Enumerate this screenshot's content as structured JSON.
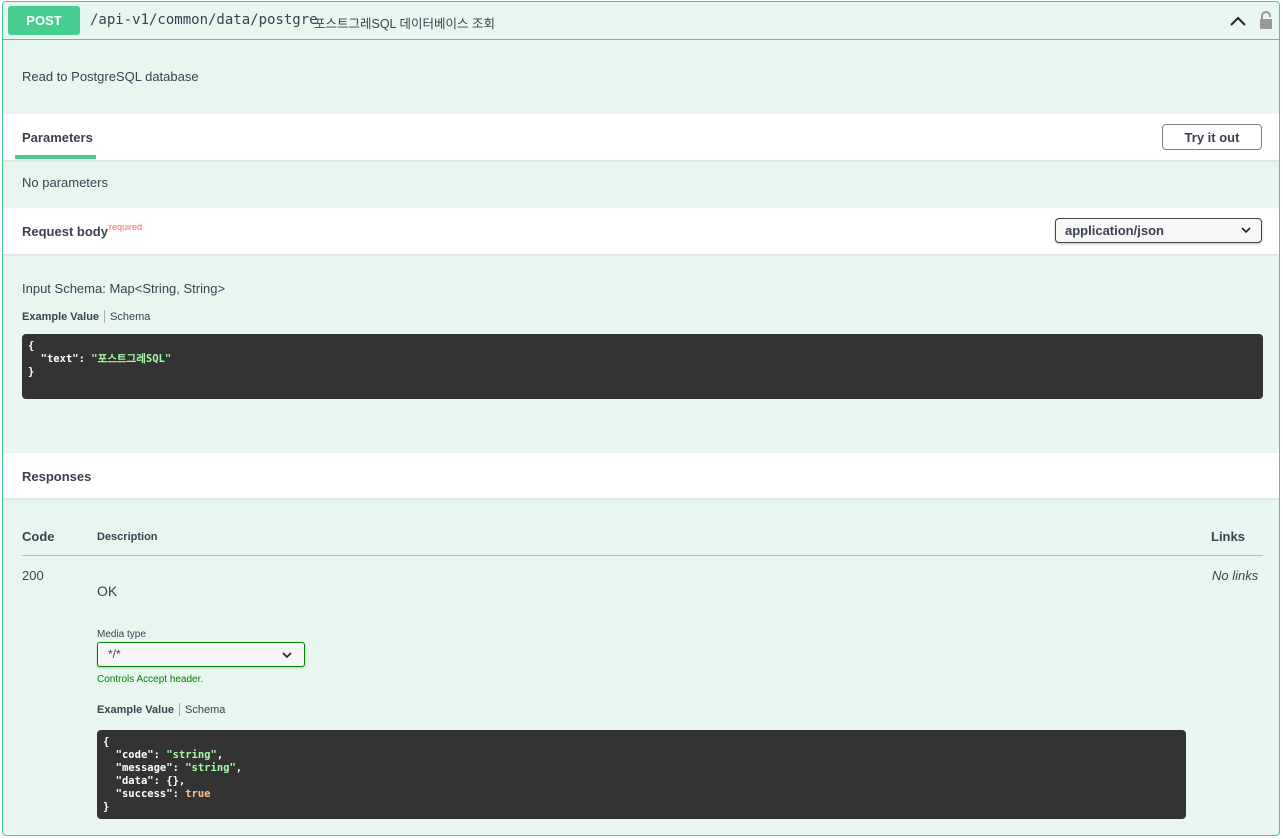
{
  "endpoint": {
    "method": "POST",
    "path": "/api-v1/common/data/postgre",
    "summary": "포스트그레SQL 데이터베이스 조회",
    "description": "Read to PostgreSQL database"
  },
  "parameters": {
    "title": "Parameters",
    "try_button": "Try it out",
    "empty_text": "No parameters"
  },
  "request_body": {
    "title": "Request body",
    "required_label": "required",
    "content_type": "application/json",
    "input_schema": "Input Schema: Map<String, String>",
    "tab_example": "Example Value",
    "tab_schema": "Schema",
    "example": {
      "open": "{",
      "key": "\"text\"",
      "colon": ": ",
      "value": "\"포스트그레SQL\"",
      "close": "}"
    }
  },
  "responses": {
    "title": "Responses",
    "col_code": "Code",
    "col_description": "Description",
    "col_links": "Links",
    "row": {
      "code": "200",
      "description": "OK",
      "links": "No links",
      "media_type_label": "Media type",
      "media_type": "*/*",
      "controls_note": "Controls Accept header.",
      "tab_example": "Example Value",
      "tab_schema": "Schema",
      "example": {
        "open": "{",
        "code_key": "\"code\"",
        "code_val": "\"string\"",
        "message_key": "\"message\"",
        "message_val": "\"string\"",
        "data_key": "\"data\"",
        "data_val": "{}",
        "success_key": "\"success\"",
        "success_val": "true",
        "close": "}"
      }
    }
  },
  "colors": {
    "post": "#49cc90",
    "background": "#e8f6f0",
    "code_bg": "#333333",
    "string": "#a2fca2",
    "boolean": "#fcc28c",
    "required": "#ff6060"
  }
}
